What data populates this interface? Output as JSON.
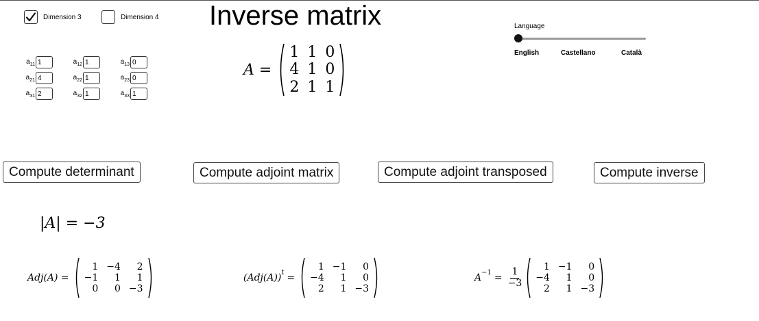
{
  "title": "Inverse matrix",
  "dimensions": [
    {
      "label": "Dimension 3",
      "checked": true
    },
    {
      "label": "Dimension 4",
      "checked": false
    }
  ],
  "entries": {
    "a11": "1",
    "a12": "1",
    "a13": "0",
    "a21": "4",
    "a22": "1",
    "a23": "0",
    "a31": "2",
    "a32": "1",
    "a33": "1"
  },
  "matrix_label": "A =",
  "matrix": [
    [
      "1",
      "1",
      "0"
    ],
    [
      "4",
      "1",
      "0"
    ],
    [
      "2",
      "1",
      "1"
    ]
  ],
  "language": {
    "label": "Language",
    "options": [
      "English",
      "Castellano",
      "Català"
    ],
    "selected": "English",
    "selected_index": 0
  },
  "buttons": {
    "determinant": "Compute determinant",
    "adjoint": "Compute adjoint matrix",
    "adjoint_transposed": "Compute adjoint transposed",
    "inverse": "Compute inverse"
  },
  "determinant_text": "|A| = −3",
  "adjoint": {
    "label": "Adj(A) =",
    "matrix": [
      [
        "1",
        "−4",
        "2"
      ],
      [
        "−1",
        "1",
        "1"
      ],
      [
        "0",
        "0",
        "−3"
      ]
    ]
  },
  "adjoint_transposed": {
    "label": "(Adj(A))",
    "sup": "t",
    "eq": "=",
    "matrix": [
      [
        "1",
        "−1",
        "0"
      ],
      [
        "−4",
        "1",
        "0"
      ],
      [
        "2",
        "1",
        "−3"
      ]
    ]
  },
  "inverse": {
    "label": "A",
    "sup": "−1",
    "eq": "=",
    "frac_num": "1",
    "frac_den": "−3",
    "matrix": [
      [
        "1",
        "−1",
        "0"
      ],
      [
        "−4",
        "1",
        "0"
      ],
      [
        "2",
        "1",
        "−3"
      ]
    ]
  }
}
